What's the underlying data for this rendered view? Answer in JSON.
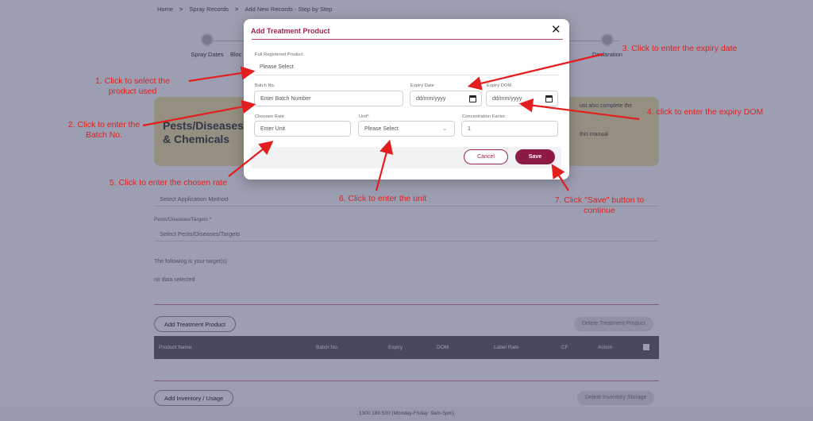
{
  "breadcrumb": [
    "Home",
    "Spray Records",
    "Add New Records - Step by Step"
  ],
  "breadcrumb_separator": ">",
  "stepper": {
    "visible_steps": [
      "Spray Dates",
      "Bloc",
      "Declaration"
    ]
  },
  "info_card": {
    "title": "Pests/Diseases/ & Chemicals",
    "side_text_1": "ust also complete the",
    "side_text_2": "this manual"
  },
  "background": {
    "application_method_placeholder": "Select Application Method",
    "pests_label": "Pests/Diseases/Targets *",
    "pests_placeholder": "Select Pests/Diseases/Targets",
    "targets_info": "The following is your target(s)",
    "no_data": "no data selected",
    "add_treatment_button": "Add Treatment Product",
    "delete_treatment_button": "Delete Treatment Product",
    "table_columns": [
      "Product Name",
      "Batch No.",
      "Expiry",
      "DOM",
      "Label Rate",
      "CF",
      "Action"
    ],
    "add_inventory_button": "Add Inventory / Usage",
    "delete_inventory_button": "Delete Inventory Storage",
    "footer": "1300 188 500 (Monday-Friday: 9am-5pm)"
  },
  "modal": {
    "title": "Add Treatment Product",
    "close_glyph": "✕",
    "product": {
      "label": "Full Registered Product",
      "value": "Please Select"
    },
    "batch": {
      "label": "Batch No.",
      "placeholder": "Enter Batch Number"
    },
    "expiry": {
      "label": "Expiry Date",
      "placeholder": "dd/mm/yyyy"
    },
    "dom": {
      "label": "Expiry DOM",
      "placeholder": "dd/mm/yyyy"
    },
    "rate": {
      "label": "Choosen Rate",
      "placeholder": "Enter Unit"
    },
    "unit": {
      "label": "Unit*",
      "value": "Please Select"
    },
    "cf": {
      "label": "Concentration Factor",
      "value": "1"
    },
    "cancel_label": "Cancel",
    "save_label": "Save"
  },
  "annotations": {
    "a1": "1. Click to select the product used",
    "a2": "2. Click to enter the Batch No.",
    "a3": "3. Click to enter the expiry date",
    "a4": "4. click to enter the expiry DOM",
    "a5": "5. Click to enter the chosen rate",
    "a6": "6. Click to enter the unit",
    "a7": "7. Click \"Save\" button to continue",
    "color": "#e41e1e"
  },
  "colors": {
    "brand": "#9b2550",
    "save_bg": "#8d1a44",
    "overlay": "#141846"
  }
}
